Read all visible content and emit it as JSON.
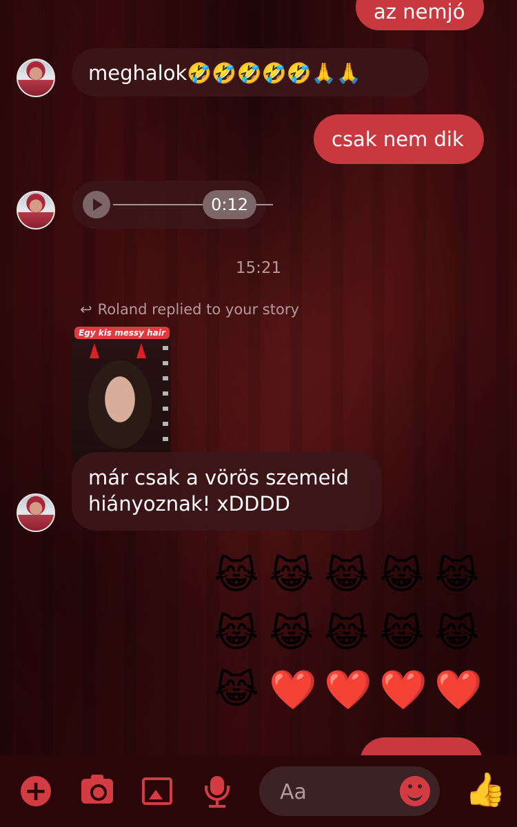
{
  "messages": {
    "m1_text": "az nemjó",
    "m2_text": "meghalok🤣🤣🤣🤣🤣🙏🙏",
    "m3_text": "csak nem dik",
    "audio_duration": "0:12",
    "timestamp": "15:21",
    "reply_note": "Roland replied to your story",
    "story_banner": "Egy kis messy hair",
    "m5_line1": "már csak a vörös szemeid",
    "m5_line2": "hiányoznak! xDDDD"
  },
  "emoji_grid": {
    "row1": [
      "😹",
      "😹",
      "😹",
      "😹",
      "😹"
    ],
    "row2": [
      "😹",
      "😹",
      "😹",
      "😹",
      "😹"
    ],
    "row3": [
      "😹",
      "❤️",
      "❤️",
      "❤️",
      "❤️"
    ]
  },
  "composer": {
    "placeholder": "Aa"
  },
  "icons": {
    "add": "plus-icon",
    "camera": "camera-icon",
    "gallery": "gallery-icon",
    "mic": "microphone-icon",
    "emoji": "emoji-icon",
    "like": "thumbs-up-icon"
  },
  "colors": {
    "accent": "#d23c42",
    "outgoing_bubble": "#c8393f",
    "incoming_bubble": "#3c1618"
  }
}
